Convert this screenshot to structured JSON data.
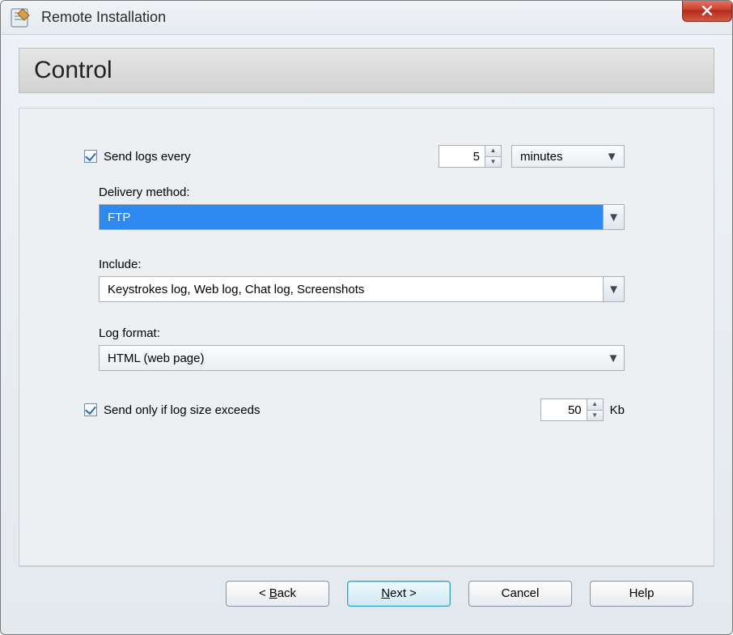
{
  "titlebar": {
    "title": "Remote Installation",
    "close_label": "x"
  },
  "heading": "Control",
  "sendLogs": {
    "label": "Send logs every",
    "checked": true,
    "value": "5",
    "unit": "minutes"
  },
  "delivery": {
    "label": "Delivery method:",
    "value": "FTP"
  },
  "include": {
    "label": "Include:",
    "value": "Keystrokes log, Web log, Chat log, Screenshots"
  },
  "logFormat": {
    "label": "Log format:",
    "value": "HTML (web page)"
  },
  "sendOnly": {
    "label": "Send only if log size exceeds",
    "checked": true,
    "value": "50",
    "unit": "Kb"
  },
  "buttons": {
    "back_prefix": "< ",
    "back": "Back",
    "back_key": "B",
    "next": "Next",
    "next_key": "N",
    "next_suffix": " >",
    "cancel": "Cancel",
    "help": "Help"
  }
}
